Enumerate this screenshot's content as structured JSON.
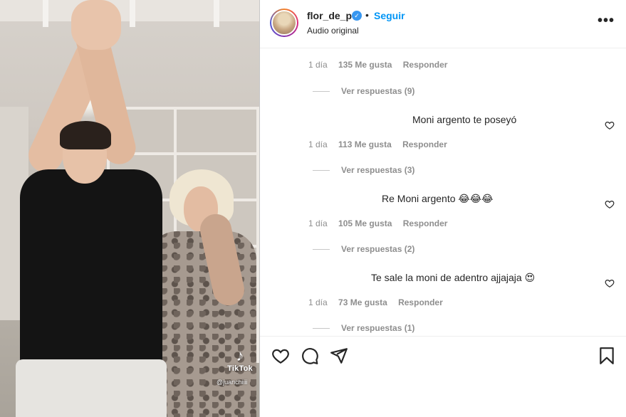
{
  "video": {
    "watermark_brand": "TikTok",
    "watermark_user": "@juanchiiii"
  },
  "header": {
    "username": "flor_de_p",
    "verified_icon": "verified-badge-icon",
    "separator": "•",
    "follow_label": "Seguir",
    "audio_label": "Audio original",
    "more_icon": "more-options-icon",
    "more_glyph": "•••"
  },
  "comments": [
    {
      "text": "",
      "time": "1 día",
      "likes": "135 Me gusta",
      "reply_label": "Responder",
      "view_replies": "Ver respuestas (9)"
    },
    {
      "text": "Moni argento te poseyó",
      "time": "1 día",
      "likes": "113 Me gusta",
      "reply_label": "Responder",
      "view_replies": "Ver respuestas (3)"
    },
    {
      "text": "Re Moni argento 😂😂😂",
      "time": "1 día",
      "likes": "105 Me gusta",
      "reply_label": "Responder",
      "view_replies": "Ver respuestas (2)"
    },
    {
      "text": "Te sale la moni de adentro ajjajaja 😍",
      "time": "1 día",
      "likes": "73 Me gusta",
      "reply_label": "Responder",
      "view_replies": "Ver respuestas (1)"
    }
  ],
  "actions": {
    "like_icon": "heart-icon",
    "comment_icon": "comment-icon",
    "share_icon": "share-icon",
    "save_icon": "bookmark-icon"
  },
  "colors": {
    "accent": "#0095f6",
    "verified": "#3897f0",
    "muted_text": "#8e8e8e",
    "text": "#262626"
  }
}
